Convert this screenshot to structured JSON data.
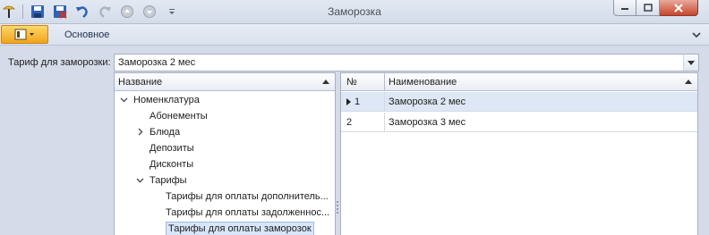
{
  "window": {
    "title": "Заморозка"
  },
  "quick_access": {
    "icons": [
      "app-icon",
      "save-icon",
      "save-close-icon",
      "undo-icon",
      "redo-icon",
      "up-icon",
      "down-icon",
      "customize-icon"
    ]
  },
  "ribbon": {
    "tab_main": "Основное"
  },
  "form": {
    "tariff_label": "Тариф для заморозки:",
    "tariff_value": "Заморозка 2 мес"
  },
  "tree": {
    "column_header": "Название",
    "items": [
      {
        "label": "Номенклатура",
        "level": 0,
        "expander": "expanded"
      },
      {
        "label": "Абонементы",
        "level": 1,
        "expander": "none"
      },
      {
        "label": "Блюда",
        "level": 1,
        "expander": "collapsed"
      },
      {
        "label": "Депозиты",
        "level": 1,
        "expander": "none"
      },
      {
        "label": "Дисконты",
        "level": 1,
        "expander": "none"
      },
      {
        "label": "Тарифы",
        "level": 1,
        "expander": "expanded"
      },
      {
        "label": "Тарифы для оплаты дополнитель...",
        "level": 2,
        "expander": "none"
      },
      {
        "label": "Тарифы для оплаты задолженнос...",
        "level": 2,
        "expander": "none"
      },
      {
        "label": "Тарифы для оплаты заморозок",
        "level": 2,
        "expander": "none",
        "selected": true
      }
    ]
  },
  "grid": {
    "headers": {
      "num": "№",
      "name": "Наименование"
    },
    "rows": [
      {
        "num": "1",
        "name": "Заморозка 2 мес",
        "focused": true
      },
      {
        "num": "2",
        "name": "Заморозка 3 мес",
        "focused": false
      }
    ]
  },
  "colors": {
    "accent": "#f4a21a",
    "selection": "#d7e6fa",
    "window_bg": "#d6dbe9"
  }
}
